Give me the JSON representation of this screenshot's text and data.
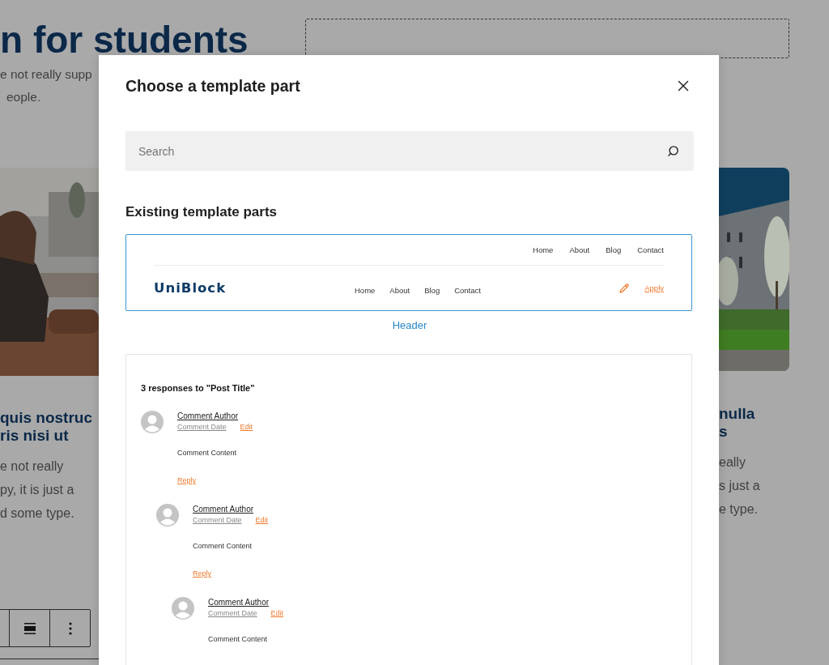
{
  "background_page": {
    "heading": "n for students",
    "intro": [
      "e not really supp",
      "eople."
    ],
    "columns": [
      {
        "title": [
          "quis nostruc",
          "ris nisi ut"
        ],
        "body": [
          "e not really",
          "py, it is just a",
          "d some type."
        ]
      },
      {
        "title": [
          "nulla",
          "s"
        ],
        "body": [
          "eally",
          "s just a",
          "e type."
        ]
      }
    ]
  },
  "dialog": {
    "title": "Choose a template part",
    "search": {
      "placeholder": "Search"
    },
    "section_title": "Existing template parts",
    "parts": [
      {
        "kind": "header",
        "name": "Header",
        "preview": {
          "top_nav": [
            "Home",
            "About",
            "Blog",
            "Contact"
          ],
          "logo": "UniBlock",
          "nav": [
            "Home",
            "About",
            "Blog",
            "Contact"
          ],
          "cta": "Apply"
        }
      },
      {
        "kind": "comments",
        "preview": {
          "title": "3 responses to \"Post Title\"",
          "comments": [
            {
              "author": "Comment Author",
              "date": "Comment Date",
              "edit": "Edit",
              "content": "Comment Content",
              "reply": "Reply",
              "children": [
                {
                  "author": "Comment Author",
                  "date": "Comment Date",
                  "edit": "Edit",
                  "content": "Comment Content",
                  "reply": "Reply",
                  "children": [
                    {
                      "author": "Comment Author",
                      "date": "Comment Date",
                      "edit": "Edit",
                      "content": "Comment Content"
                    }
                  ]
                }
              ]
            }
          ]
        }
      }
    ]
  }
}
